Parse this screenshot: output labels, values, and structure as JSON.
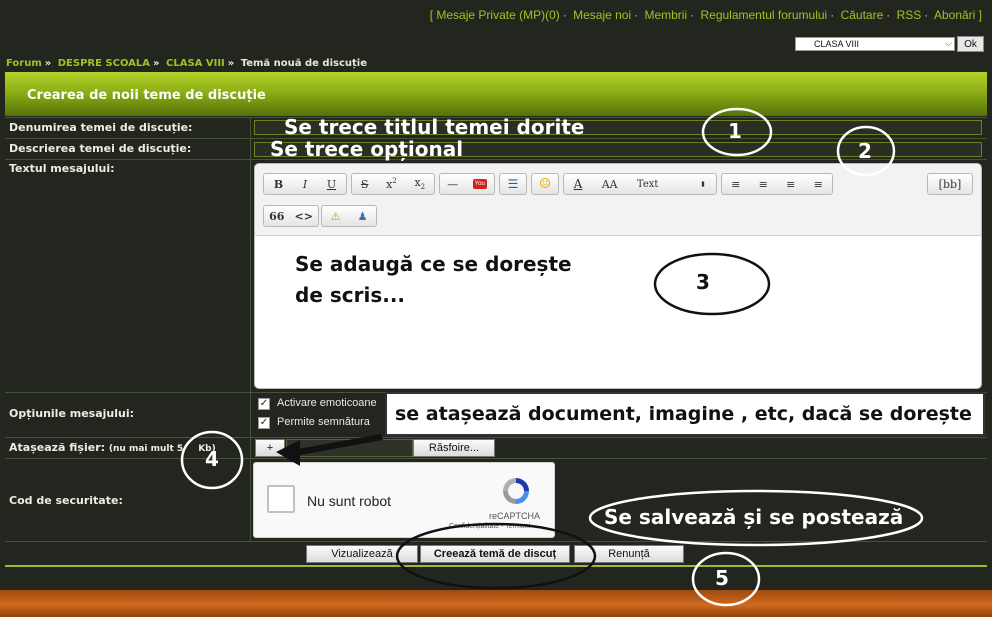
{
  "top_links": [
    "[ Mesaje Private (MP)(0)",
    "Mesaje noi",
    "Membrii",
    "Regulamentul forumului",
    "Căutare",
    "RSS",
    "Abonări ]"
  ],
  "forum_select": {
    "value": "CLASA VIII",
    "go_label": "Ok"
  },
  "breadcrumb": {
    "forum": "Forum",
    "cat": "DESPRE SCOALA",
    "sub": "CLASA VIII",
    "current": "Temă nouă de discuție"
  },
  "form": {
    "header": "Crearea de noii teme de discuție",
    "title_label": "Denumirea temei de discuție:",
    "desc_label": "Descrierea temei de discuție:",
    "text_label": "Textul mesajului:",
    "options_label": "Opțiunile mesajului:",
    "attach_label": "Atașează fișier:",
    "attach_note": "(nu mai mult 5",
    "attach_note_tail": "Kb)",
    "security_label": "Cod de securitate:",
    "opt_emoticons": "Activare emoticoane",
    "opt_signature": "Permite semnătura",
    "browse_label": "Răsfoire...",
    "attach_plus": "+",
    "btn_preview": "Vizualizează",
    "btn_create": "Creează temă de discuț",
    "btn_cancel": "Renunță"
  },
  "editor": {
    "bold": "B",
    "italic": "I",
    "underline": "U",
    "strike": "S",
    "sup": "x",
    "sub": "x",
    "hr": "—",
    "youtube": "You",
    "font_size": "AA",
    "font_family": "Text",
    "source": "[bb]",
    "quote": "66",
    "code": "<>",
    "body_line1": "Se adaugă ce se dorește",
    "body_line2": "de scris..."
  },
  "recaptcha": {
    "label": "Nu sunt robot",
    "brand": "reCAPTCHA",
    "terms": "Confidențialitate - Termeni"
  },
  "annotations": {
    "title_hint": "Se trece titlul temei dorite",
    "desc_hint": "Se trece opțional",
    "attach_hint": "se atașează document, imagine , etc, dacă se dorește",
    "post_hint": "Se salvează și se postează",
    "n1": "1",
    "n2": "2",
    "n3": "3",
    "n4": "4",
    "n5": "5"
  }
}
